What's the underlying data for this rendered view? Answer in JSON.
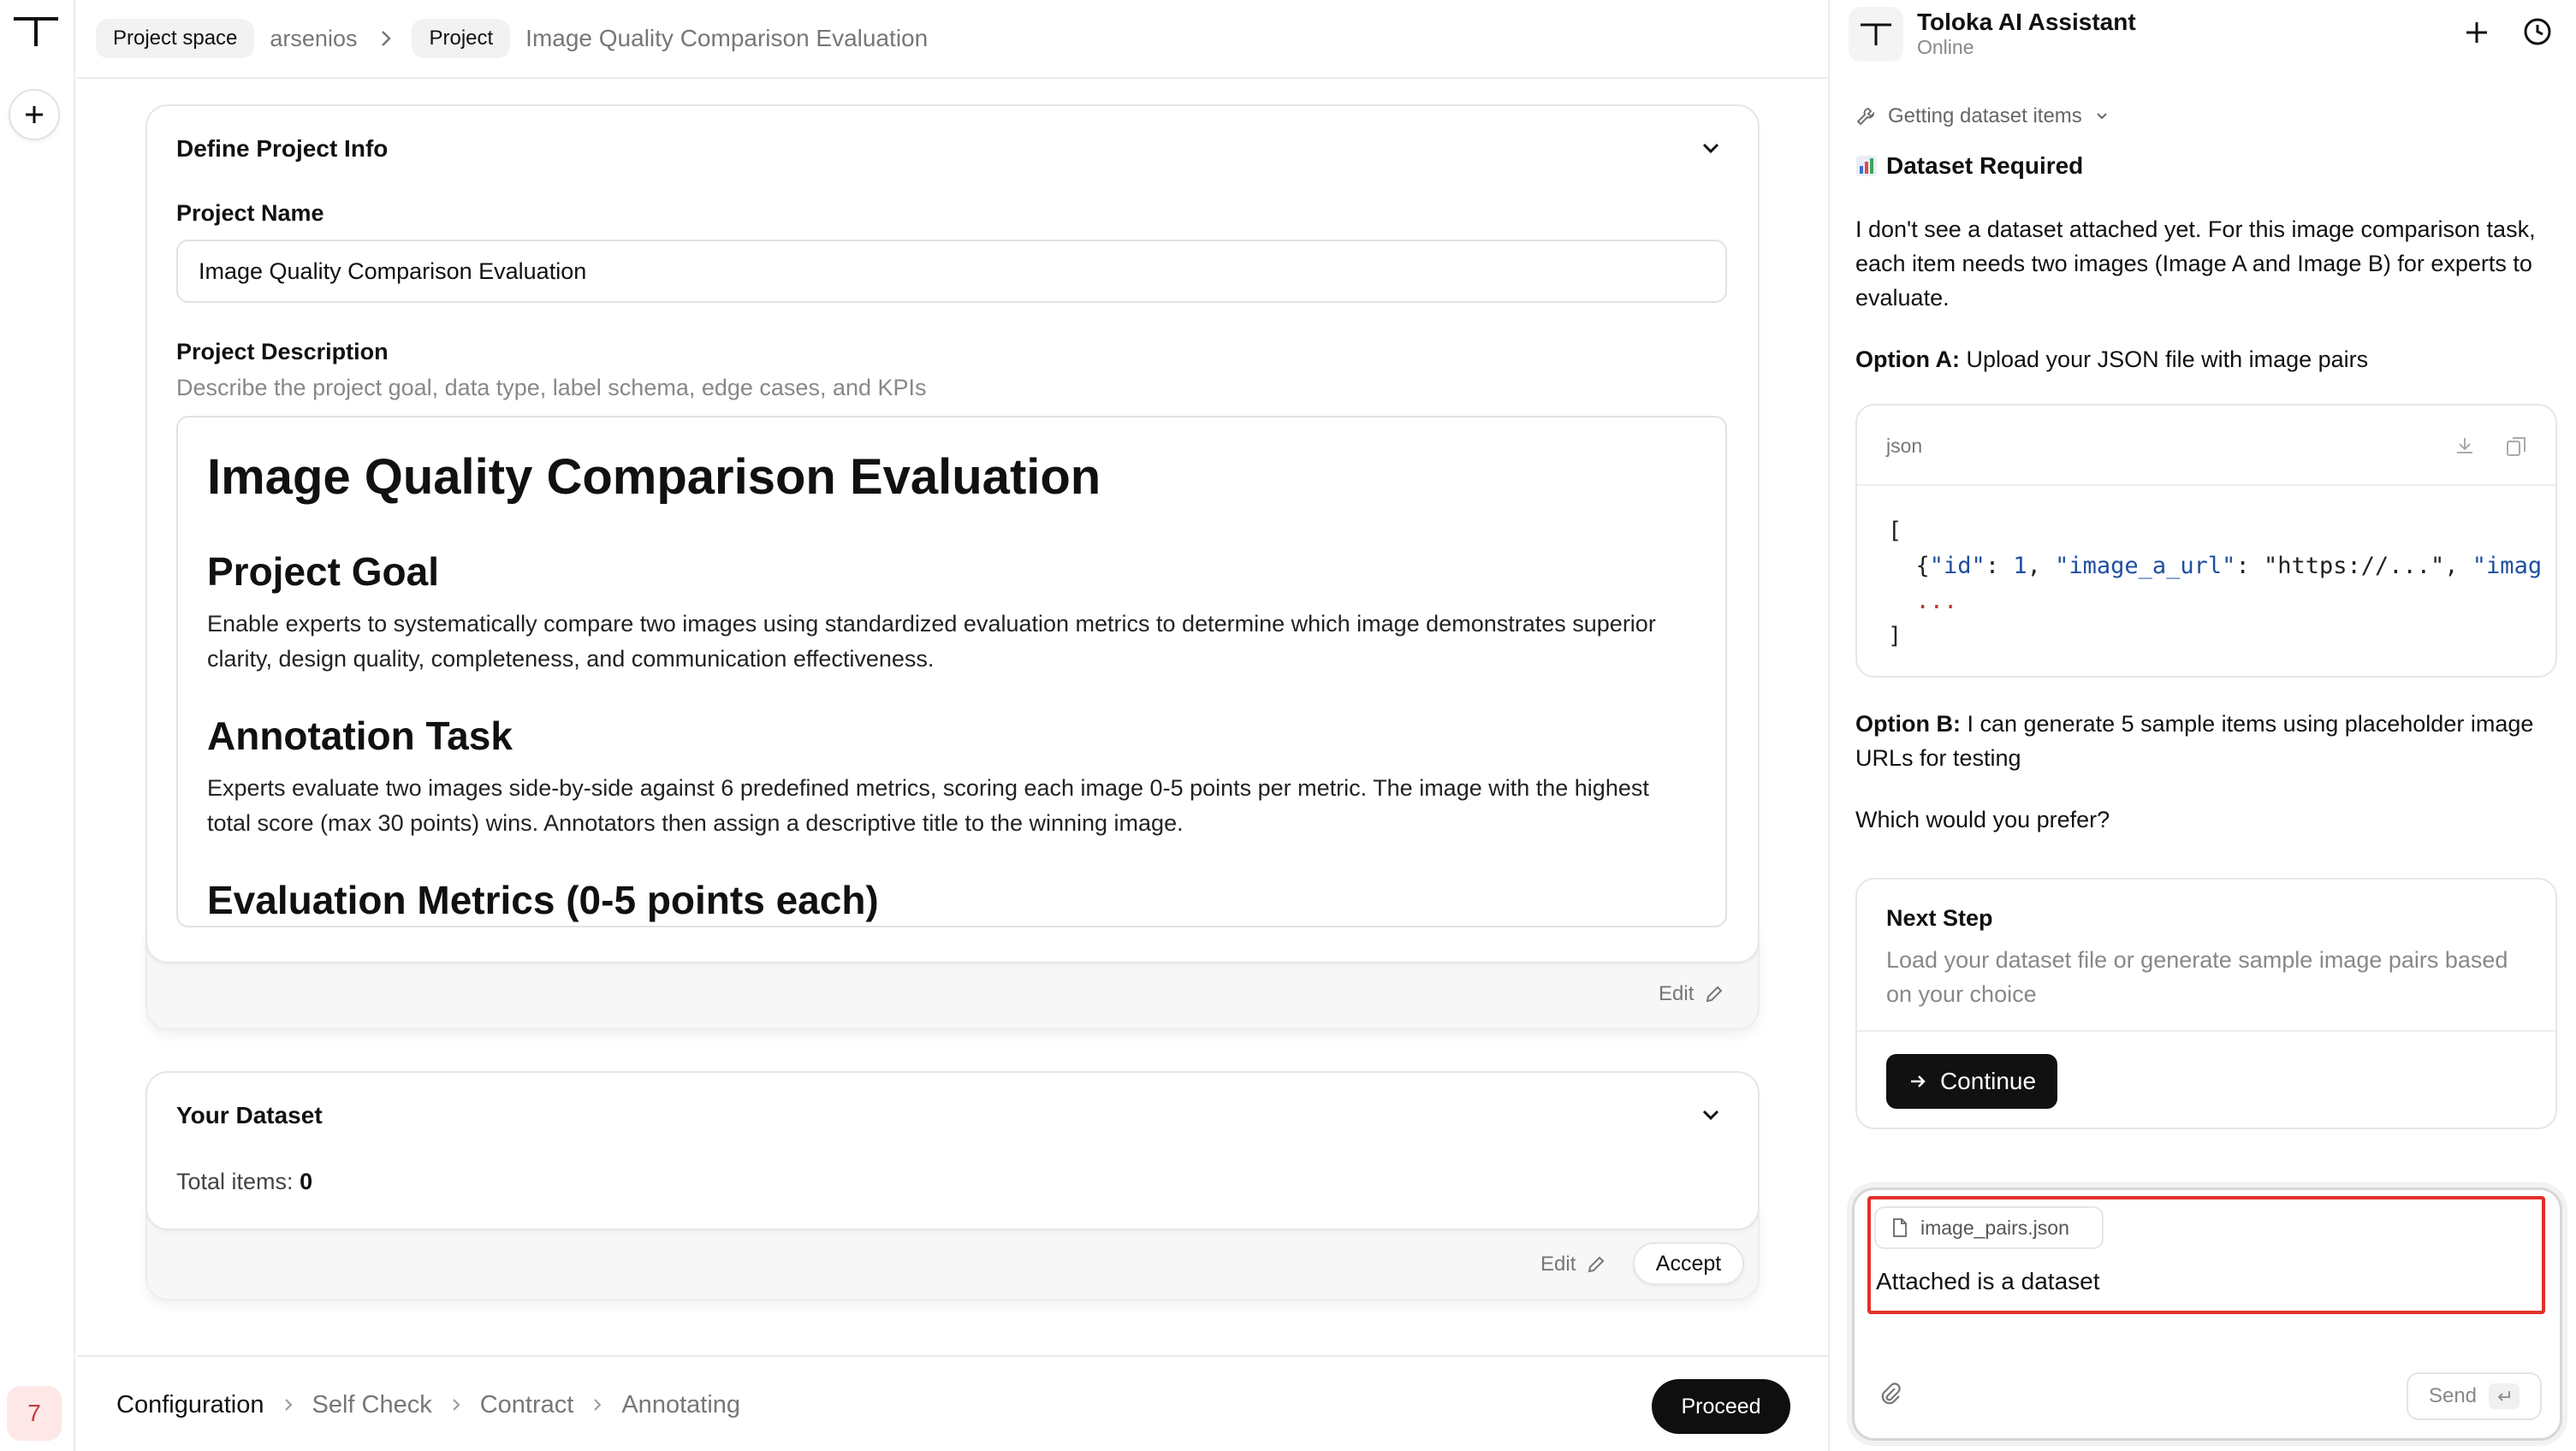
{
  "breadcrumb": {
    "project_space": "Project space",
    "user": "arsenios",
    "project": "Project",
    "title": "Image Quality Comparison Evaluation"
  },
  "rail": {
    "badge": "7"
  },
  "define_card": {
    "title": "Define Project Info",
    "name_label": "Project Name",
    "name_value": "Image Quality Comparison Evaluation",
    "desc_label": "Project Description",
    "desc_hint": "Describe the project goal, data type, label schema, edge cases, and KPIs",
    "doc": {
      "h1": "Image Quality Comparison Evaluation",
      "goal_heading": "Project Goal",
      "goal_text": "Enable experts to systematically compare two images using standardized evaluation metrics to determine which image demonstrates superior clarity, design quality, completeness, and communication effectiveness.",
      "task_heading": "Annotation Task",
      "task_text": "Experts evaluate two images side-by-side against 6 predefined metrics, scoring each image 0-5 points per metric. The image with the highest total score (max 30 points) wins. Annotators then assign a descriptive title to the winning image.",
      "metrics_heading": "Evaluation Metrics (0-5 points each)"
    },
    "edit_label": "Edit"
  },
  "dataset_card": {
    "title": "Your Dataset",
    "total_label": "Total items:",
    "total_value": "0",
    "edit_label": "Edit",
    "accept_label": "Accept"
  },
  "steps": {
    "items": [
      "Configuration",
      "Self Check",
      "Contract",
      "Annotating"
    ],
    "active": "Configuration",
    "proceed_label": "Proceed"
  },
  "assistant": {
    "name": "Toloka AI Assistant",
    "status": "Online",
    "tool_status": "Getting dataset items",
    "section_title": "Dataset Required",
    "intro": "I don't see a dataset attached yet. For this image comparison task, each item needs two images (Image A and Image B) for experts to evaluate.",
    "option_a_label": "Option A:",
    "option_a_text": "Upload your JSON file with image pairs",
    "code": {
      "lang": "json",
      "line1": "[",
      "line2_key1": "\"id\"",
      "line2_val1": "1",
      "line2_key2": "\"image_a_url\"",
      "line2_val2": "\"https://...\"",
      "line2_key3": "\"imag",
      "line3": "...",
      "line4": "]"
    },
    "option_b_label": "Option B:",
    "option_b_text": "I can generate 5 sample items using placeholder image URLs for testing",
    "question": "Which would you prefer?",
    "next_step": {
      "title": "Next Step",
      "description": "Load your dataset file or generate sample image pairs based on your choice",
      "button": "Continue"
    }
  },
  "composer": {
    "attachment": "image_pairs.json",
    "text": "Attached is a dataset",
    "send_label": "Send"
  },
  "colors": {
    "highlight": "#e0302a",
    "primary_button": "#0f0f0f",
    "badge_bg": "#fde7e7",
    "badge_text": "#c23b3b"
  }
}
